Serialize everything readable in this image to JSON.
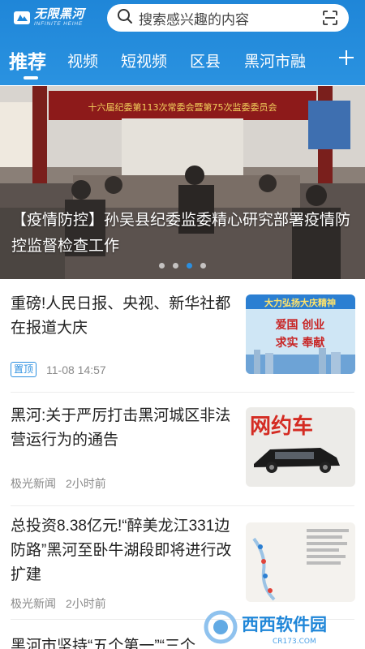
{
  "header": {
    "logo_main": "无限黑河",
    "logo_sub": "INFINITE HEIHE",
    "search_placeholder": "搜索感兴趣的内容",
    "search_icon": "search-icon",
    "scan_icon": "scan-icon",
    "brand_color": "#2a8fdf"
  },
  "tabs": [
    {
      "label": "推荐",
      "active": true
    },
    {
      "label": "视频",
      "active": false
    },
    {
      "label": "短视频",
      "active": false
    },
    {
      "label": "区县",
      "active": false
    },
    {
      "label": "黑河市融",
      "active": false
    }
  ],
  "banner": {
    "caption": "【疫情防控】孙吴县纪委监委精心研究部署疫情防控监督检查工作",
    "photo_banner_text": "十六届纪委第113次常委会暨第75次监委委员会",
    "slide_count": 4,
    "active_slide": 3
  },
  "news": [
    {
      "title": "重磅!人民日报、央视、新华社都在报道大庆",
      "pinned_label": "置顶",
      "source": "",
      "time": "11-08 14:57",
      "thumb_text_top": "大力弘扬大庆精神",
      "thumb_text_mid": "爱国 创业",
      "thumb_text_bottom": "求实 奉献"
    },
    {
      "title": "黑河:关于严厉打击黑河城区非法营运行为的通告",
      "pinned_label": "",
      "source": "极光新闻",
      "time": "2小时前",
      "thumb_text_top": "网约车"
    },
    {
      "title": "总投资8.38亿元!“醉美龙江331边防路”黑河至卧牛湖段即将进行改扩建",
      "pinned_label": "",
      "source": "极光新闻",
      "time": "2小时前"
    },
    {
      "title": "黑河市坚持“五个第一”“三个",
      "pinned_label": "",
      "source": "",
      "time": ""
    }
  ],
  "watermark": {
    "text": "西西软件园",
    "sub": "CR173.COM"
  }
}
